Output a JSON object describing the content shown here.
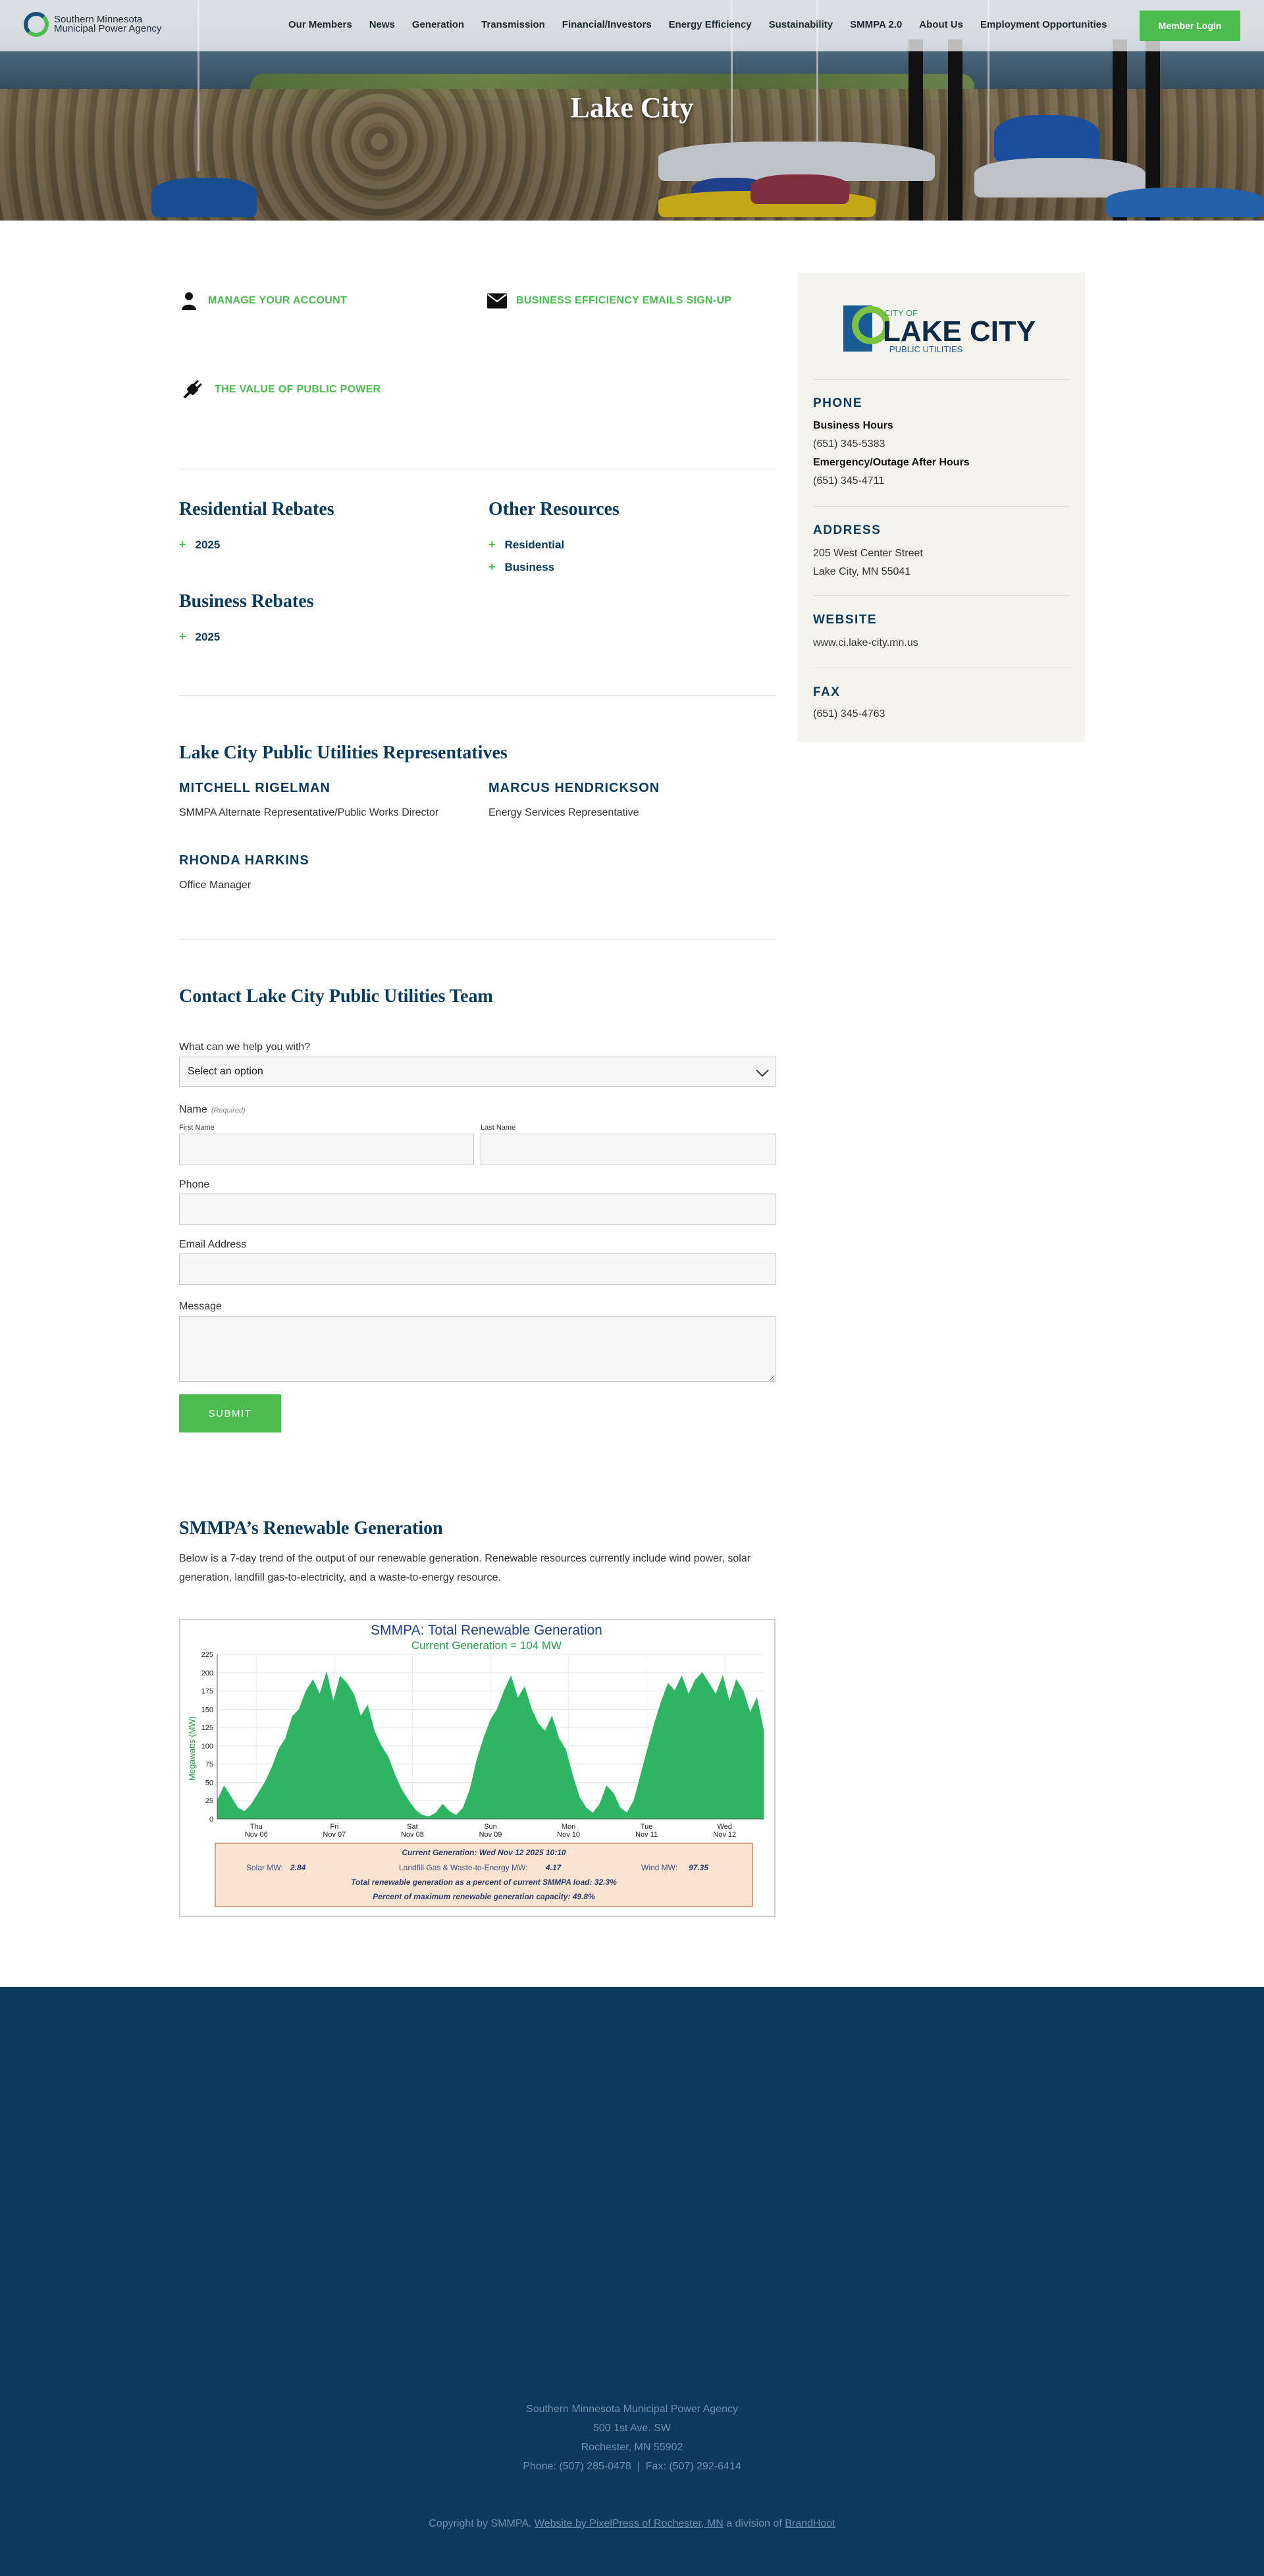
{
  "header": {
    "logo_line1": "Southern Minnesota",
    "logo_line2": "Municipal Power Agency",
    "nav": [
      "Our Members",
      "News",
      "Generation",
      "Transmission",
      "Financial/Investors",
      "Energy Efficiency",
      "Sustainability",
      "SMMPA 2.0",
      "About Us",
      "Employment Opportunities"
    ],
    "member_login": "Member Login"
  },
  "hero": {
    "title": "Lake City"
  },
  "quick_links": {
    "manage_account": "MANAGE YOUR ACCOUNT",
    "business_emails": "BUSINESS EFFICIENCY EMAILS SIGN-UP",
    "value_public_power": "THE VALUE OF PUBLIC POWER"
  },
  "rebates": {
    "residential_title": "Residential Rebates",
    "residential_items": [
      "2025"
    ],
    "business_title": "Business Rebates",
    "business_items": [
      "2025"
    ],
    "other_title": "Other Resources",
    "other_items": [
      "Residential",
      "Business"
    ]
  },
  "representatives": {
    "title": "Lake City Public Utilities Representatives",
    "people": [
      {
        "name": "MITCHELL RIGELMAN",
        "role": "SMMPA Alternate Representative/Public Works Director"
      },
      {
        "name": "MARCUS HENDRICKSON",
        "role": "Energy Services Representative"
      },
      {
        "name": "RHONDA HARKINS",
        "role": "Office Manager"
      }
    ]
  },
  "contact_form": {
    "title": "Contact Lake City Public Utilities Team",
    "help_label": "What can we help you with?",
    "help_value": "Select an option",
    "name_label": "Name",
    "name_required": "(Required)",
    "first_name": "First Name",
    "last_name": "Last Name",
    "phone_label": "Phone",
    "email_label": "Email Address",
    "message_label": "Message",
    "submit": "SUBMIT"
  },
  "renewable": {
    "title": "SMMPA’s Renewable Generation",
    "description": "Below is a 7-day trend of the output of our renewable generation. Renewable resources currently include wind power, solar generation, landfill gas-to-electricity, and a waste-to-energy resource."
  },
  "chart_data": {
    "type": "area",
    "title": "SMMPA: Total Renewable Generation",
    "subtitle": "Current Generation = 104 MW",
    "xlabel": "",
    "ylabel": "Megawatts (MW)",
    "ylim": [
      0,
      225
    ],
    "yticks": [
      0,
      25,
      50,
      75,
      100,
      125,
      150,
      175,
      200,
      225
    ],
    "x_tick_labels": [
      [
        "Thu",
        "Nov 06"
      ],
      [
        "Fri",
        "Nov 07"
      ],
      [
        "Sat",
        "Nov 08"
      ],
      [
        "Sun",
        "Nov 09"
      ],
      [
        "Mon",
        "Nov 10"
      ],
      [
        "Tue",
        "Nov 11"
      ],
      [
        "Wed",
        "Nov 12"
      ]
    ],
    "grid": true,
    "color": "#2db563",
    "series": [
      {
        "values": [
          25,
          45,
          30,
          15,
          10,
          20,
          35,
          50,
          70,
          95,
          110,
          140,
          150,
          175,
          190,
          170,
          200,
          160,
          195,
          185,
          170,
          140,
          155,
          120,
          100,
          85,
          60,
          40,
          25,
          12,
          5,
          3,
          8,
          20,
          10,
          5,
          15,
          40,
          80,
          110,
          135,
          150,
          175,
          195,
          165,
          180,
          150,
          130,
          120,
          140,
          110,
          95,
          60,
          30,
          15,
          8,
          20,
          45,
          35,
          15,
          8,
          25,
          60,
          95,
          130,
          160,
          185,
          175,
          195,
          170,
          190,
          200,
          185,
          170,
          195,
          160,
          190,
          175,
          145,
          165,
          120
        ]
      }
    ],
    "summary": {
      "current": "Current Generation: Wed Nov 12 2025 10:10",
      "solar_label": "Solar MW:",
      "solar_value": "2.84",
      "landfill_label": "Landfill Gas & Waste-to-Energy MW:",
      "landfill_value": "4.17",
      "wind_label": "Wind MW:",
      "wind_value": "97.35",
      "pct_load": "Total renewable generation as a percent of current SMMPA load: 32.3%",
      "pct_capacity": "Percent of maximum renewable generation capacity: 49.8%"
    }
  },
  "sidebar": {
    "logo_small": "CITY OF",
    "logo_big": "LAKE CITY",
    "logo_sub": "PUBLIC UTILITIES",
    "phone_head": "PHONE",
    "business_hours": "Business Hours",
    "business_phone": "(651) 345-5383",
    "emergency": "Emergency/Outage After Hours",
    "emergency_phone": "(651) 345-4711",
    "address_head": "ADDRESS",
    "address1": "205 West Center Street",
    "address2": "Lake City, MN 55041",
    "website_head": "WEBSITE",
    "website": "www.ci.lake-city.mn.us",
    "fax_head": "FAX",
    "fax": "(651) 345-4763"
  },
  "footer": {
    "org": "Southern Minnesota Municipal Power Agency",
    "street": "500 1st Ave. SW",
    "city": "Rochester, MN 55902",
    "phone_fax": "Phone: (507) 285-0478  |  Fax: (507) 292-6414",
    "copyright_prefix": "Copyright by SMMPA.",
    "credit_link": "Website by PixelPress of Rochester, MN",
    "division_text": "a division of",
    "brandhoot": "BrandHoot"
  }
}
